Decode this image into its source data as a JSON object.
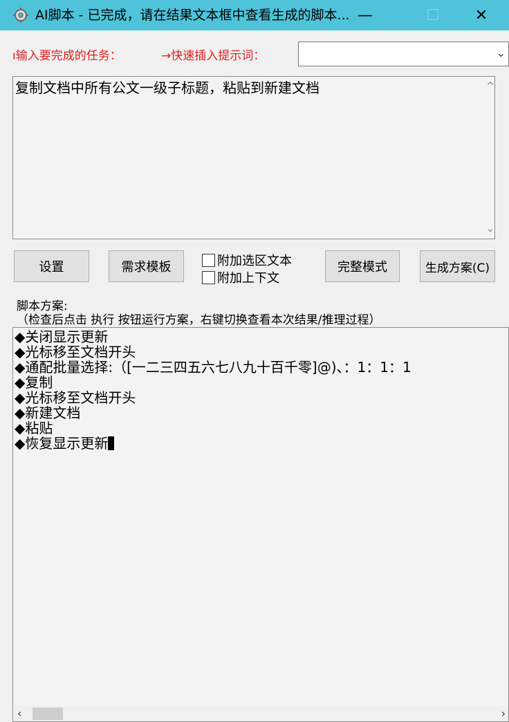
{
  "window": {
    "title": "AI脚本 - 已完成，请在结果文本框中查看生成的脚本...",
    "minimize": "—",
    "maximize": "☐",
    "close": "✕",
    "colors": {
      "titlebar": "#4ec3d9",
      "label": "#e02020"
    }
  },
  "inputs": {
    "task_label": "输入要完成的任务：",
    "quick_label": "快速插入提示词：",
    "quick_value": "",
    "task_text": "复制文档中所有公文一级子标题，粘贴到新建文档"
  },
  "buttons": {
    "settings": "设置",
    "template": "需求模板",
    "full_mode": "完整模式",
    "generate": "生成方案(C)"
  },
  "checkboxes": {
    "attach_selection": "附加选区文本",
    "attach_context": "附加上下文"
  },
  "plan": {
    "label": "脚本方案:",
    "hint": "（检查后点击 执行 按钮运行方案，右键切换查看本次结果/推理过程）",
    "lines": [
      "◆关闭显示更新",
      "◆光标移至文档开头",
      "◆通配批量选择:（[一二三四五六七八九十百千零]@)、：1：1：1",
      "◆复制",
      "◆光标移至文档开头",
      "◆新建文档",
      "◆粘贴",
      "◆恢复显示更新"
    ]
  }
}
